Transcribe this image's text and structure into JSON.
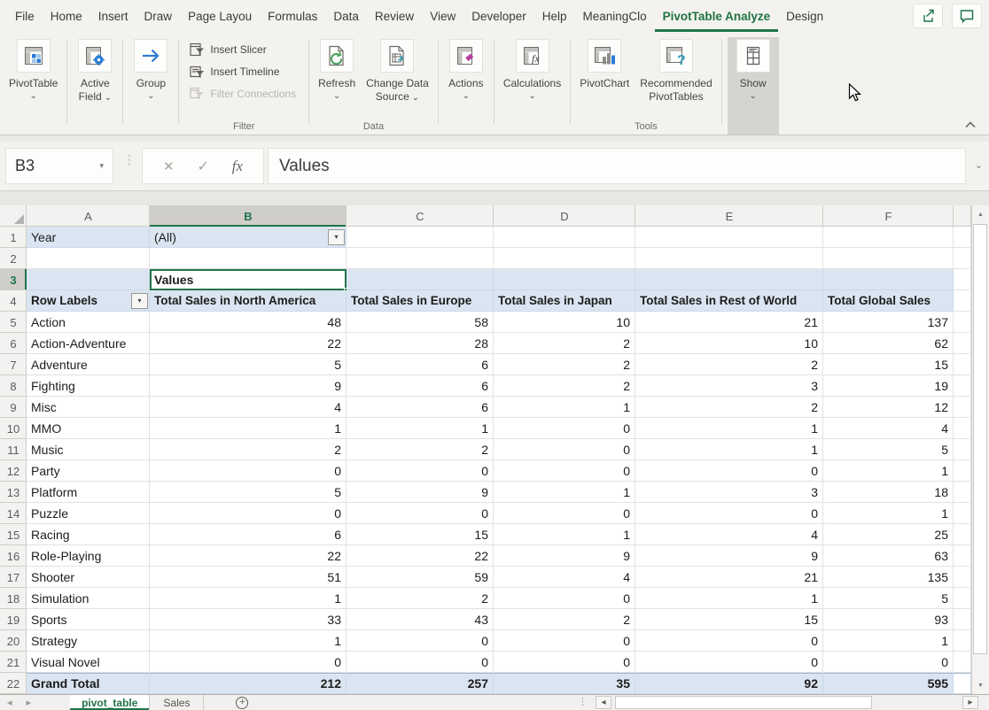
{
  "menu_tabs": {
    "active_index": 12,
    "items": [
      "File",
      "Home",
      "Insert",
      "Draw",
      "Page Layou",
      "Formulas",
      "Data",
      "Review",
      "View",
      "Developer",
      "Help",
      "MeaningClo",
      "PivotTable Analyze",
      "Design"
    ]
  },
  "ribbon": {
    "pivottable_label": "PivotTable",
    "active_field_line1": "Active",
    "active_field_line2": "Field",
    "group_label": "Group",
    "filter": {
      "insert_slicer": "Insert Slicer",
      "insert_timeline": "Insert Timeline",
      "filter_connections": "Filter Connections",
      "group_label": "Filter"
    },
    "data": {
      "refresh": "Refresh",
      "change_data_line1": "Change Data",
      "change_data_line2": "Source",
      "group_label": "Data"
    },
    "actions_label": "Actions",
    "calculations_label": "Calculations",
    "tools": {
      "pivotchart": "PivotChart",
      "recommended_line1": "Recommended",
      "recommended_line2": "PivotTables",
      "group_label": "Tools"
    },
    "show_label": "Show"
  },
  "formula_bar": {
    "name_box": "B3",
    "formula": "Values"
  },
  "sheet": {
    "row_numbers": [
      "1",
      "2",
      "3",
      "4"
    ],
    "column_letters": [
      "A",
      "B",
      "C",
      "D",
      "E",
      "F"
    ],
    "selected_column": "B",
    "filter_field": {
      "label": "Year",
      "value": "(All)"
    },
    "values_cell": "Values",
    "header_row": {
      "row_label": "Row Labels",
      "columns": [
        "Total Sales in North America",
        "Total Sales in Europe",
        "Total Sales in Japan",
        "Total Sales in Rest of World",
        "Total Global Sales"
      ]
    },
    "rows": [
      {
        "label": "Action",
        "values": [
          48,
          58,
          10,
          21,
          137
        ]
      },
      {
        "label": "Action-Adventure",
        "values": [
          22,
          28,
          2,
          10,
          62
        ]
      },
      {
        "label": "Adventure",
        "values": [
          5,
          6,
          2,
          2,
          15
        ]
      },
      {
        "label": "Fighting",
        "values": [
          9,
          6,
          2,
          3,
          19
        ]
      },
      {
        "label": "Misc",
        "values": [
          4,
          6,
          1,
          2,
          12
        ]
      },
      {
        "label": "MMO",
        "values": [
          1,
          1,
          0,
          1,
          4
        ]
      },
      {
        "label": "Music",
        "values": [
          2,
          2,
          0,
          1,
          5
        ]
      },
      {
        "label": "Party",
        "values": [
          0,
          0,
          0,
          0,
          1
        ]
      },
      {
        "label": "Platform",
        "values": [
          5,
          9,
          1,
          3,
          18
        ]
      },
      {
        "label": "Puzzle",
        "values": [
          0,
          0,
          0,
          0,
          1
        ]
      },
      {
        "label": "Racing",
        "values": [
          6,
          15,
          1,
          4,
          25
        ]
      },
      {
        "label": "Role-Playing",
        "values": [
          22,
          22,
          9,
          9,
          63
        ]
      },
      {
        "label": "Shooter",
        "values": [
          51,
          59,
          4,
          21,
          135
        ]
      },
      {
        "label": "Simulation",
        "values": [
          1,
          2,
          0,
          1,
          5
        ]
      },
      {
        "label": "Sports",
        "values": [
          33,
          43,
          2,
          15,
          93
        ]
      },
      {
        "label": "Strategy",
        "values": [
          1,
          0,
          0,
          0,
          1
        ]
      },
      {
        "label": "Visual Novel",
        "values": [
          0,
          0,
          0,
          0,
          0
        ]
      },
      {
        "label": "Grand Total",
        "values": [
          212,
          257,
          35,
          92,
          595
        ],
        "total": true
      }
    ]
  },
  "sheet_tabs": {
    "active": "pivot_table",
    "other": "Sales"
  },
  "glyphs": {
    "dropdown": "▾",
    "chevron_down": "⌄",
    "close": "✕",
    "check": "✓",
    "fx": "fx",
    "plus": "+",
    "up_arrow": "▲",
    "down_arrow": "▼",
    "left_arrow": "◂",
    "right_arrow": "▸",
    "dots": "⋮"
  },
  "colors": {
    "accent_green": "#217346",
    "pivot_blue": "#dbe5f1"
  }
}
